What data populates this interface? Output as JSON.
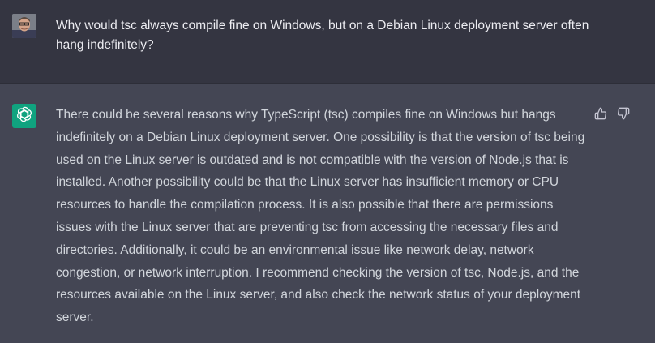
{
  "conversation": {
    "user_message": {
      "text": "Why would tsc always compile fine on Windows, but on a Debian Linux deployment server often hang indefinitely?"
    },
    "assistant_message": {
      "text": "There could be several reasons why TypeScript (tsc) compiles fine on Windows but hangs indefinitely on a Debian Linux deployment server. One possibility is that the version of tsc being used on the Linux server is outdated and is not compatible with the version of Node.js that is installed. Another possibility could be that the Linux server has insufficient memory or CPU resources to handle the compilation process. It is also possible that there are permissions issues with the Linux server that are preventing tsc from accessing the necessary files and directories. Additionally, it could be an environmental issue like network delay, network congestion, or network interruption. I recommend checking the version of tsc, Node.js, and the resources available on the Linux server, and also check the network status of your deployment server."
    }
  },
  "icons": {
    "user_avatar": "user-avatar-photo",
    "assistant_avatar": "openai-logo-icon",
    "thumbs_up": "thumbs-up-icon",
    "thumbs_down": "thumbs-down-icon"
  },
  "colors": {
    "user_row_bg": "#343541",
    "assistant_row_bg": "#444654",
    "assistant_avatar_bg": "#10a37f",
    "user_text": "#ececf1",
    "assistant_text": "#d1d5db"
  }
}
